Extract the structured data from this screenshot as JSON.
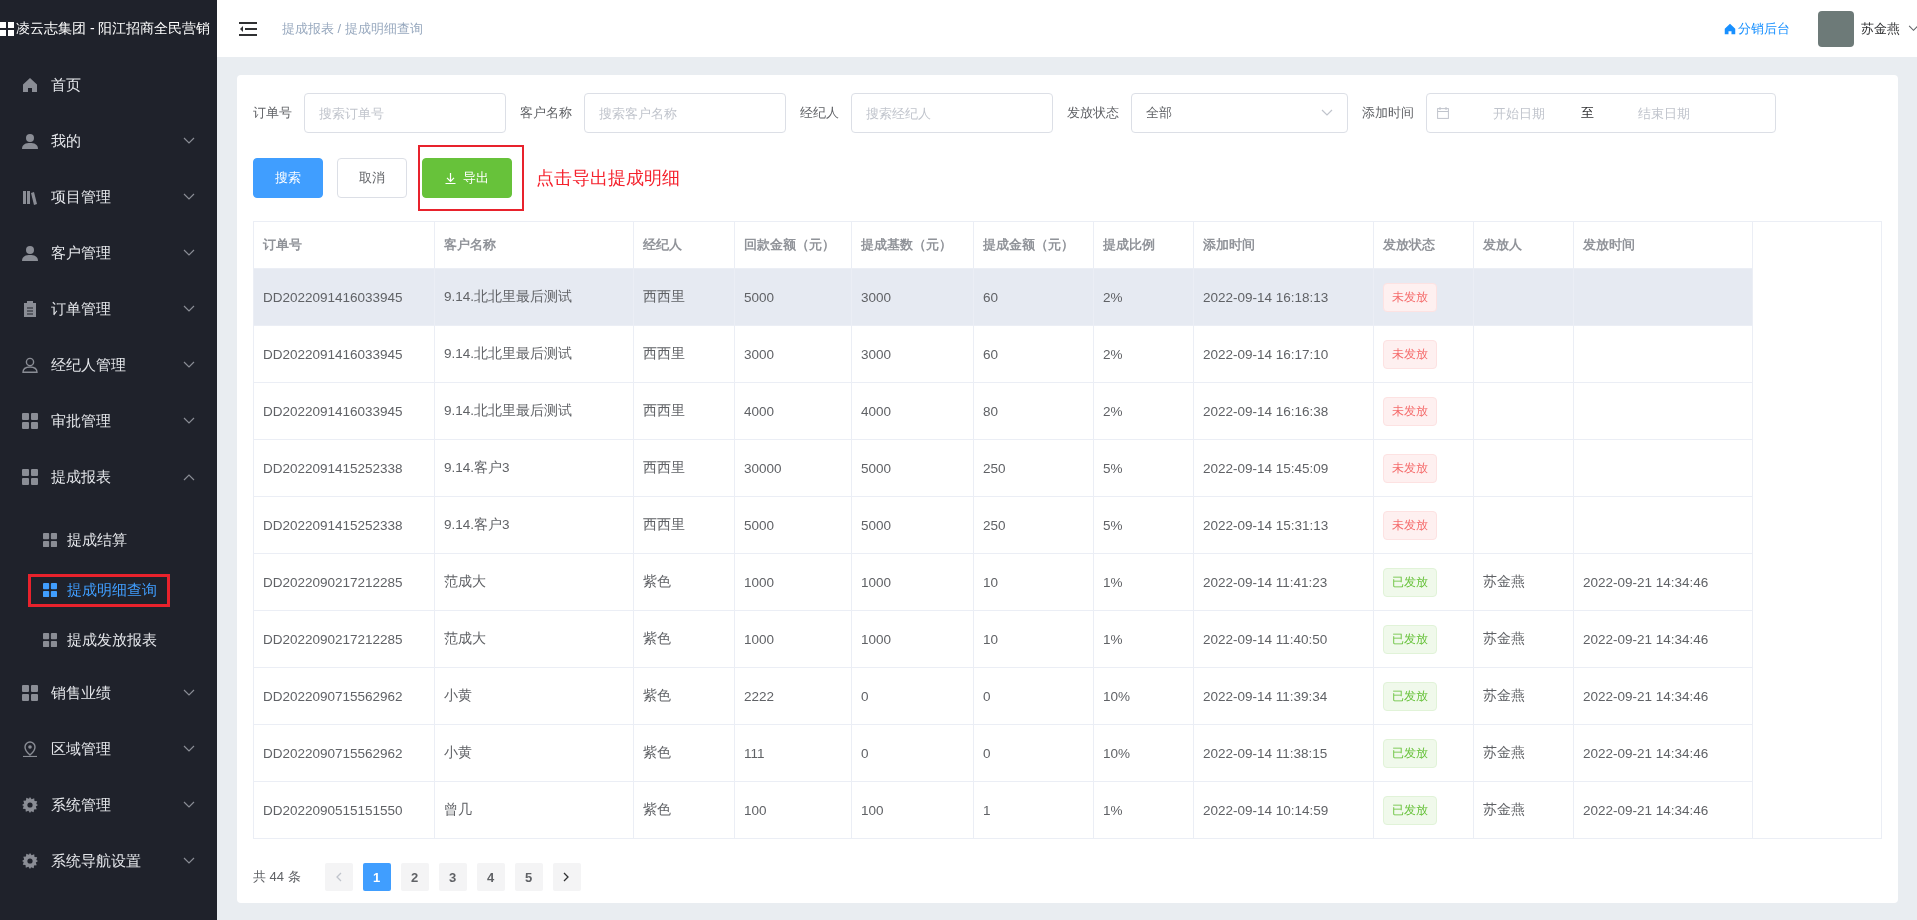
{
  "sidebar": {
    "title": "凌云志集团 - 阳江招商全民营销",
    "items": [
      {
        "label": "首页",
        "kind": "link"
      },
      {
        "label": "我的",
        "kind": "group",
        "expanded": false
      },
      {
        "label": "项目管理",
        "kind": "group",
        "expanded": false
      },
      {
        "label": "客户管理",
        "kind": "group",
        "expanded": false
      },
      {
        "label": "订单管理",
        "kind": "group",
        "expanded": false
      },
      {
        "label": "经纪人管理",
        "kind": "group",
        "expanded": false
      },
      {
        "label": "审批管理",
        "kind": "group",
        "expanded": false
      },
      {
        "label": "提成报表",
        "kind": "group",
        "expanded": true,
        "children": [
          {
            "label": "提成结算",
            "selected": false,
            "highlighted": false
          },
          {
            "label": "提成明细查询",
            "selected": true,
            "highlighted": true
          },
          {
            "label": "提成发放报表",
            "selected": false,
            "highlighted": false
          }
        ]
      },
      {
        "label": "销售业绩",
        "kind": "group",
        "expanded": false
      },
      {
        "label": "区域管理",
        "kind": "group",
        "expanded": false
      },
      {
        "label": "系统管理",
        "kind": "group",
        "expanded": false
      },
      {
        "label": "系统导航设置",
        "kind": "group",
        "expanded": false
      }
    ]
  },
  "header": {
    "breadcrumb": "提成报表 / 提成明细查询",
    "link": "分销后台",
    "user": "苏金燕"
  },
  "filters": [
    {
      "kind": "text",
      "label": "订单号",
      "placeholder": "搜索订单号"
    },
    {
      "kind": "text",
      "label": "客户名称",
      "placeholder": "搜索客户名称"
    },
    {
      "kind": "text",
      "label": "经纪人",
      "placeholder": "搜索经纪人"
    },
    {
      "kind": "select",
      "label": "发放状态",
      "value": "全部"
    },
    {
      "kind": "daterange",
      "label": "添加时间",
      "start_placeholder": "开始日期",
      "separator": "至",
      "end_placeholder": "结束日期"
    }
  ],
  "buttons": [
    {
      "label": "搜索",
      "kind": "primary",
      "highlighted": false
    },
    {
      "label": "取消",
      "kind": "plain",
      "highlighted": false
    },
    {
      "label": "导出",
      "kind": "export",
      "highlighted": true
    }
  ],
  "annotation": "点击导出提成明细",
  "table": {
    "columns": [
      "订单号",
      "客户名称",
      "经纪人",
      "回款金额（元）",
      "提成基数（元）",
      "提成金额（元）",
      "提成比例",
      "添加时间",
      "发放状态",
      "发放人",
      "发放时间"
    ],
    "rows": [
      {
        "selected": true,
        "cells": [
          "DD2022091416033945",
          "9.14.北北里最后测试",
          "西西里",
          "5000",
          "3000",
          "60",
          "2%",
          "2022-09-14 16:18:13"
        ],
        "status": {
          "text": "未发放",
          "kind": "pending"
        },
        "issuer": "",
        "issued_at": ""
      },
      {
        "selected": false,
        "cells": [
          "DD2022091416033945",
          "9.14.北北里最后测试",
          "西西里",
          "3000",
          "3000",
          "60",
          "2%",
          "2022-09-14 16:17:10"
        ],
        "status": {
          "text": "未发放",
          "kind": "pending"
        },
        "issuer": "",
        "issued_at": ""
      },
      {
        "selected": false,
        "cells": [
          "DD2022091416033945",
          "9.14.北北里最后测试",
          "西西里",
          "4000",
          "4000",
          "80",
          "2%",
          "2022-09-14 16:16:38"
        ],
        "status": {
          "text": "未发放",
          "kind": "pending"
        },
        "issuer": "",
        "issued_at": ""
      },
      {
        "selected": false,
        "cells": [
          "DD2022091415252338",
          "9.14.客户3",
          "西西里",
          "30000",
          "5000",
          "250",
          "5%",
          "2022-09-14 15:45:09"
        ],
        "status": {
          "text": "未发放",
          "kind": "pending"
        },
        "issuer": "",
        "issued_at": ""
      },
      {
        "selected": false,
        "cells": [
          "DD2022091415252338",
          "9.14.客户3",
          "西西里",
          "5000",
          "5000",
          "250",
          "5%",
          "2022-09-14 15:31:13"
        ],
        "status": {
          "text": "未发放",
          "kind": "pending"
        },
        "issuer": "",
        "issued_at": ""
      },
      {
        "selected": false,
        "cells": [
          "DD2022090217212285",
          "范成大",
          "紫色",
          "1000",
          "1000",
          "10",
          "1%",
          "2022-09-14 11:41:23"
        ],
        "status": {
          "text": "已发放",
          "kind": "issued"
        },
        "issuer": "苏金燕",
        "issued_at": "2022-09-21 14:34:46"
      },
      {
        "selected": false,
        "cells": [
          "DD2022090217212285",
          "范成大",
          "紫色",
          "1000",
          "1000",
          "10",
          "1%",
          "2022-09-14 11:40:50"
        ],
        "status": {
          "text": "已发放",
          "kind": "issued"
        },
        "issuer": "苏金燕",
        "issued_at": "2022-09-21 14:34:46"
      },
      {
        "selected": false,
        "cells": [
          "DD2022090715562962",
          "小黄",
          "紫色",
          "2222",
          "0",
          "0",
          "10%",
          "2022-09-14 11:39:34"
        ],
        "status": {
          "text": "已发放",
          "kind": "issued"
        },
        "issuer": "苏金燕",
        "issued_at": "2022-09-21 14:34:46"
      },
      {
        "selected": false,
        "cells": [
          "DD2022090715562962",
          "小黄",
          "紫色",
          "111",
          "0",
          "0",
          "10%",
          "2022-09-14 11:38:15"
        ],
        "status": {
          "text": "已发放",
          "kind": "issued"
        },
        "issuer": "苏金燕",
        "issued_at": "2022-09-21 14:34:46"
      },
      {
        "selected": false,
        "cells": [
          "DD2022090515151550",
          "曾几",
          "紫色",
          "100",
          "100",
          "1",
          "1%",
          "2022-09-14 10:14:59"
        ],
        "status": {
          "text": "已发放",
          "kind": "issued"
        },
        "issuer": "苏金燕",
        "issued_at": "2022-09-21 14:34:46"
      }
    ]
  },
  "pagination": {
    "total": "共 44 条",
    "prev_disabled": true,
    "next_disabled": false,
    "pages": [
      {
        "label": "1",
        "selected": true
      },
      {
        "label": "2",
        "selected": false
      },
      {
        "label": "3",
        "selected": false
      },
      {
        "label": "4",
        "selected": false
      },
      {
        "label": "5",
        "selected": false
      }
    ]
  }
}
